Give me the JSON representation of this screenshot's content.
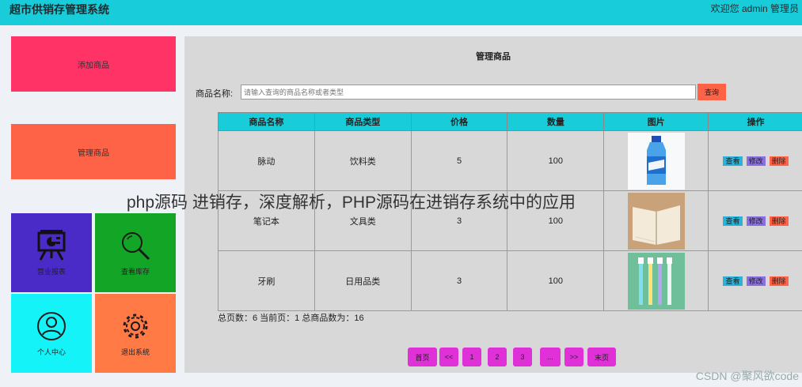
{
  "header": {
    "app_title": "超市供销存管理系统",
    "welcome_text": "欢迎您 admin 管理员"
  },
  "sidebar": {
    "add_goods_label": "添加商品",
    "manage_goods_label": "管理商品",
    "tiles": [
      {
        "label": "营业报表",
        "icon": "presentation-chart-icon"
      },
      {
        "label": "查看库存",
        "icon": "magnifier-icon"
      },
      {
        "label": "个人中心",
        "icon": "user-icon"
      },
      {
        "label": "退出系统",
        "icon": "gear-icon"
      }
    ]
  },
  "main": {
    "title": "管理商品",
    "search": {
      "label": "商品名称:",
      "placeholder": "请输入查询的商品名称或者类型",
      "button_label": "查询"
    },
    "table": {
      "columns": [
        "商品名称",
        "商品类型",
        "价格",
        "数量",
        "图片",
        "操作"
      ],
      "rows": [
        {
          "name": "脉动",
          "type": "饮料类",
          "price": "5",
          "quantity": "100",
          "image": "bottle-image"
        },
        {
          "name": "笔记本",
          "type": "文具类",
          "price": "3",
          "quantity": "100",
          "image": "notebook-image"
        },
        {
          "name": "牙刷",
          "type": "日用品类",
          "price": "3",
          "quantity": "100",
          "image": "toothbrush-image"
        }
      ],
      "actions": {
        "view": "查看",
        "edit": "修改",
        "delete": "删除"
      }
    },
    "summary": "总页数：6 当前页：1 总商品数为：16",
    "pagination": [
      "首页",
      "<<",
      "1",
      "2",
      "3",
      "...",
      ">>",
      "末页"
    ]
  },
  "overlay_title": "php源码 进销存，深度解析，PHP源码在进销存系统中的应用",
  "watermark": "CSDN @聚风欲code",
  "colors": {
    "header": "#19ccd9",
    "add_button": "#ff3366",
    "manage_button": "#ff6347",
    "tile_report": "#4b2bc7",
    "tile_stock": "#12a526",
    "tile_profile": "#14f3f7",
    "tile_exit": "#ff7a45",
    "pager": "#e030d8"
  }
}
